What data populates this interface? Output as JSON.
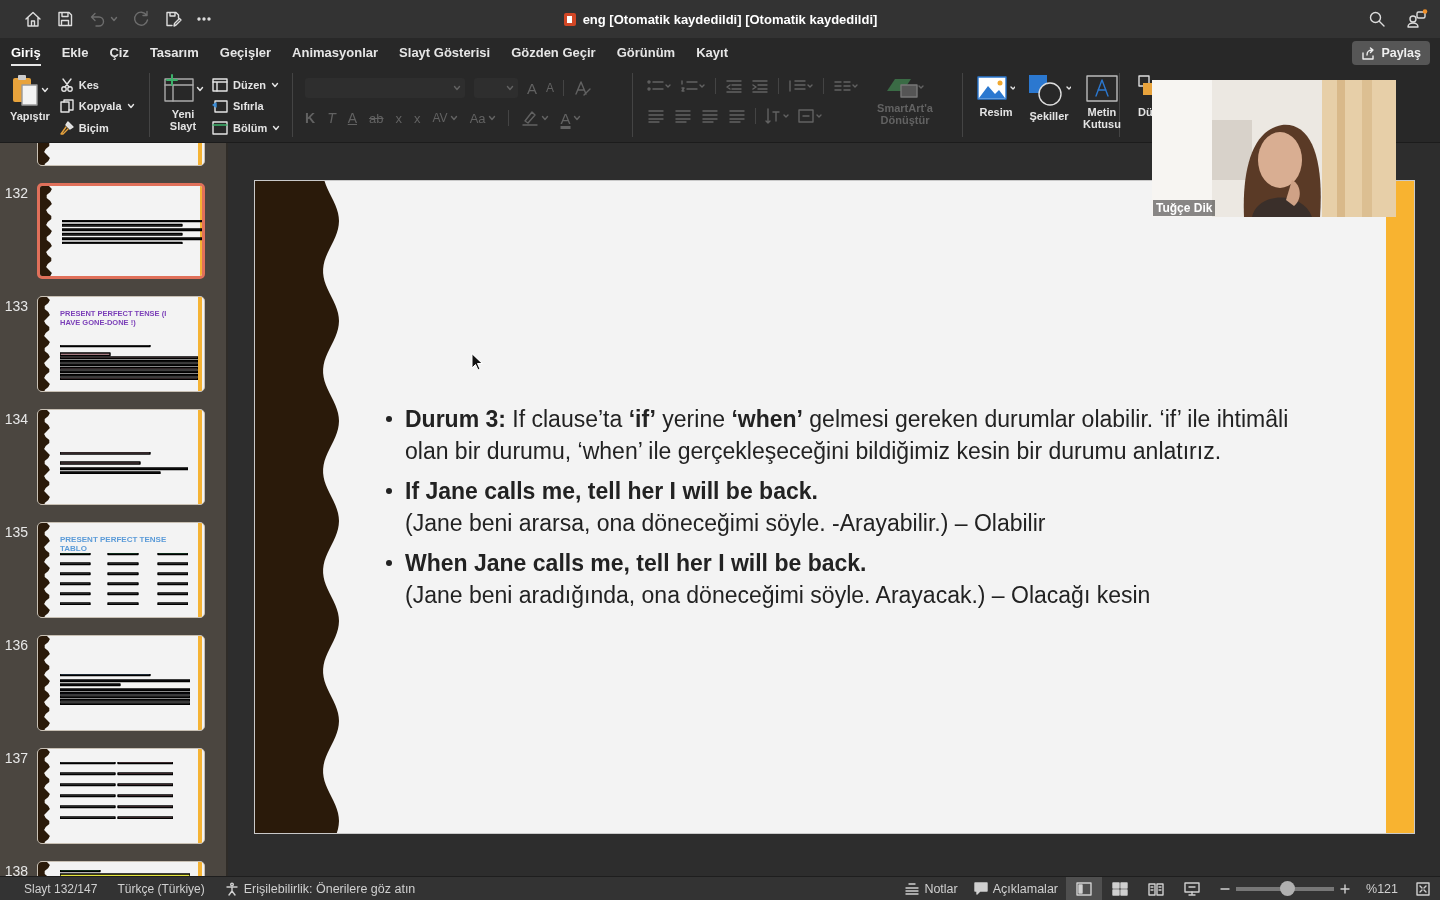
{
  "title_bar": {
    "quick_access": [
      {
        "kind": "home"
      },
      {
        "kind": "save"
      },
      {
        "kind": "undo",
        "disabled": true
      },
      {
        "kind": "redo",
        "disabled": true
      },
      {
        "kind": "save_as"
      },
      {
        "kind": "more"
      }
    ],
    "title": "eng [Otomatik kaydedildi] [Otomatik kaydedildi]"
  },
  "ribbon_tabs": [
    {
      "label": "Giriş",
      "selected": true
    },
    {
      "label": "Ekle",
      "selected": false
    },
    {
      "label": "Çiz",
      "selected": false
    },
    {
      "label": "Tasarım",
      "selected": false
    },
    {
      "label": "Geçişler",
      "selected": false
    },
    {
      "label": "Animasyonlar",
      "selected": false
    },
    {
      "label": "Slayt Gösterisi",
      "selected": false
    },
    {
      "label": "Gözden Geçir",
      "selected": false
    },
    {
      "label": "Görünüm",
      "selected": false
    },
    {
      "label": "Kayıt",
      "selected": false
    }
  ],
  "share_button": "Paylaş",
  "ribbon": {
    "clipboard": {
      "paste": "Yapıştır",
      "cut": "Kes",
      "copy": "Kopyala",
      "format_painter": "Biçim"
    },
    "slides": {
      "new_slide": "Yeni Slayt",
      "layout": "Düzen",
      "reset": "Sıfırla",
      "section": "Bölüm"
    },
    "font": {
      "disabled": true,
      "grow": "A",
      "shrink": "A",
      "bold": "K",
      "italic": "T",
      "underline": "A",
      "strikethrough": "ab",
      "superscript": "x",
      "subscript": "x",
      "spacing": "AV",
      "change_case": "Aa",
      "font_color": "A"
    },
    "paragraph": {
      "disabled": true,
      "smartart": "SmartArt'a Dönüştür"
    },
    "insert": {
      "picture": "Resim",
      "shapes": "Şekiller",
      "text_box": "Metin Kutusu"
    },
    "arrange": {
      "label": "Dü"
    }
  },
  "slides_panel": {
    "thumbnails": [
      {
        "kind": "blank",
        "selected": false
      },
      {
        "number": "132",
        "kind": "bullets",
        "selected": true
      },
      {
        "number": "133",
        "kind": "title",
        "title": "PRESENT PERFECT TENSE (I HAVE GONE-DONE !)",
        "color": "#7b3fb8",
        "selected": false
      },
      {
        "number": "134",
        "kind": "underlined",
        "selected": false
      },
      {
        "number": "135",
        "kind": "table",
        "title": "PRESENT PERFECT TENSE TABLO",
        "color": "#5b9bd8",
        "selected": false
      },
      {
        "number": "136",
        "kind": "usage",
        "selected": false
      },
      {
        "number": "137",
        "kind": "notes",
        "selected": false
      },
      {
        "number": "138",
        "kind": "highlight",
        "selected": false
      }
    ]
  },
  "slide": {
    "bullets": [
      {
        "lines": [
          {
            "text": "**Durum 3:** If clause’ta **‘if’** yerine **‘when’** gelmesi gereken durumlar olabilir. ‘if’ ile ihtimâli olan bir durumu, ‘when’ ile gerçekleşeceğini bildiğimiz kesin bir durumu anlatırız.",
            "bold": false
          }
        ]
      },
      {
        "lines": [
          {
            "text": "If Jane calls me, tell her I will be back.",
            "bold": true
          },
          {
            "text": "(Jane beni ararsa, ona döneceğimi söyle. -Arayabilir.) – Olabilir",
            "bold": false
          }
        ]
      },
      {
        "lines": [
          {
            "text": "When Jane calls me, tell her I will be back.",
            "bold": true
          },
          {
            "text": "(Jane beni aradığında, ona döneceğimi söyle. Arayacak.) – Olacağı kesin",
            "bold": false
          }
        ]
      }
    ]
  },
  "video": {
    "name": "Tuğçe Dik"
  },
  "status_bar": {
    "slide_position": "Slayt 132/147",
    "language": "Türkçe (Türkiye)",
    "accessibility": "Erişilebilirlik: Önerilere göz atın",
    "notes": "Notlar",
    "comments": "Açıklamalar",
    "views": [
      {
        "kind": "normal",
        "selected": true
      },
      {
        "kind": "sorter",
        "selected": false
      },
      {
        "kind": "reading",
        "selected": false
      },
      {
        "kind": "slideshow",
        "selected": false
      }
    ],
    "zoom": {
      "level": 0.52,
      "reading": "%121"
    }
  }
}
